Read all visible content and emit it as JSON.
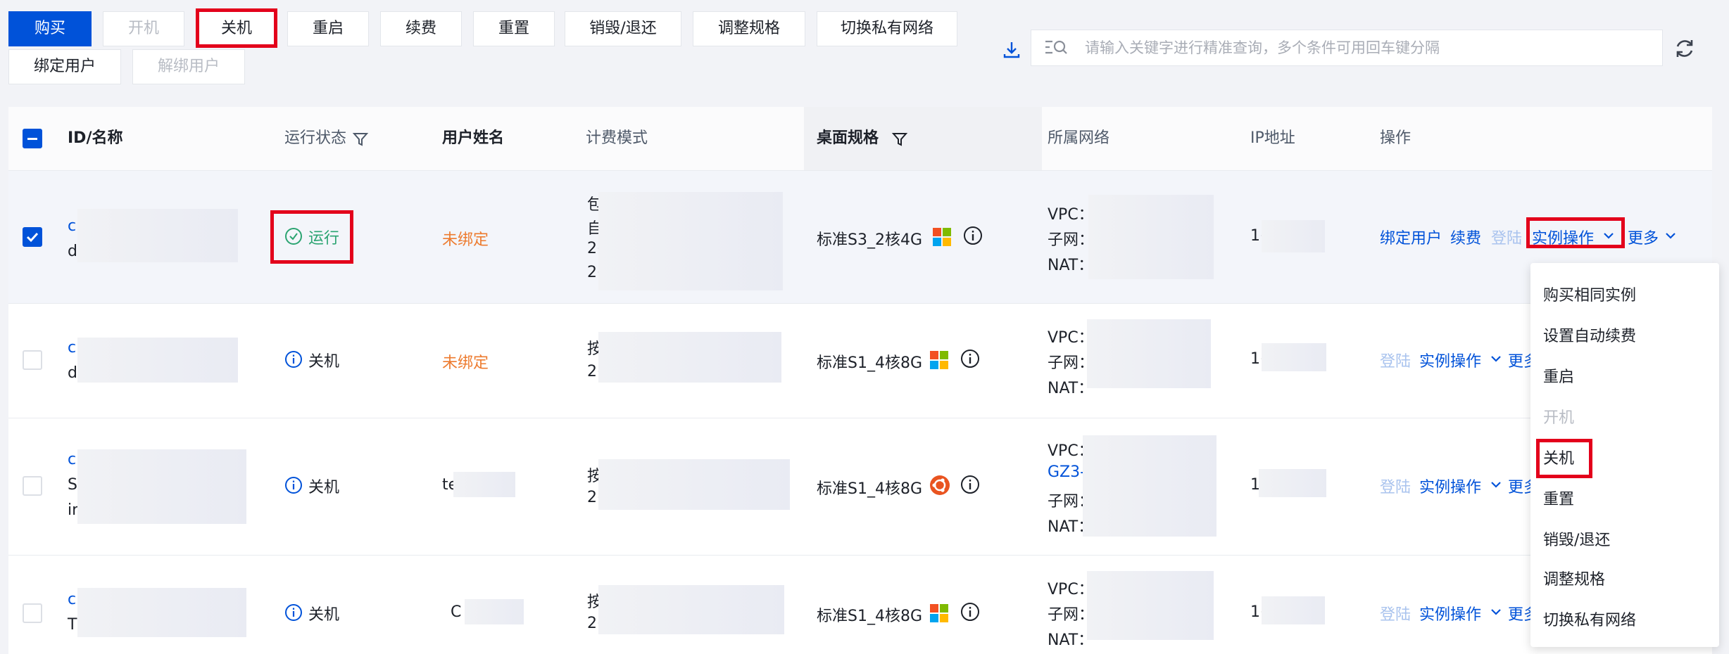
{
  "toolbar": {
    "buy": "购买",
    "start": "开机",
    "stop": "关机",
    "restart": "重启",
    "renew": "续费",
    "reset": "重置",
    "destroy": "销毁/退还",
    "resize": "调整规格",
    "switch_network": "切换私有网络",
    "bind_user": "绑定用户",
    "unbind_user": "解绑用户"
  },
  "search": {
    "placeholder": "请输入关键字进行精准查询，多个条件可用回车键分隔"
  },
  "table": {
    "headers": {
      "id_name": "ID/名称",
      "status": "运行状态",
      "username": "用户姓名",
      "billing": "计费模式",
      "spec": "桌面规格",
      "network": "所属网络",
      "ip": "IP地址",
      "actions": "操作"
    },
    "rows": [
      {
        "id_prefix": "c",
        "name_prefix": "d",
        "status": "运行",
        "user": "未绑定",
        "billing_lines": [
          "包",
          "自",
          "2(",
          "2("
        ],
        "spec": "标准S3_2核4G",
        "os": "windows",
        "net_lines": [
          "VPC：",
          "子网：",
          "NAT："
        ],
        "ip_prefix": "1(",
        "actions": [
          "绑定用户",
          "续费",
          "登陆",
          "实例操作",
          "更多"
        ]
      },
      {
        "id_prefix": "c",
        "name_prefix": "d",
        "status": "关机",
        "user": "未绑定",
        "billing_lines": [
          "按",
          "2("
        ],
        "spec": "标准S1_4核8G",
        "os": "windows",
        "net_lines": [
          "VPC：",
          "子网：",
          "NAT："
        ],
        "ip_prefix": "1(",
        "actions": [
          "登陆",
          "实例操作",
          "更多"
        ]
      },
      {
        "id_prefix": "c",
        "name_prefix": "S",
        "name_prefix2": "ir",
        "status": "关机",
        "user": "te",
        "billing_lines": [
          "按",
          "2("
        ],
        "spec": "标准S1_4核8G",
        "os": "ubuntu",
        "net_lines": [
          "VPC：",
          "GZ3-",
          "子网：",
          "NAT："
        ],
        "ip_prefix": "1",
        "actions": [
          "登陆",
          "实例操作",
          "更多"
        ]
      },
      {
        "id_prefix": "c",
        "name_prefix": "T",
        "status": "关机",
        "user": "C",
        "billing_lines": [
          "按",
          "2("
        ],
        "spec": "标准S1_4核8G",
        "os": "windows",
        "net_lines": [
          "VPC：",
          "子网：",
          "NAT："
        ],
        "ip_prefix": "1(",
        "actions": [
          "登陆",
          "实例操作",
          "更多"
        ]
      }
    ]
  },
  "dropdown": {
    "items": [
      "购买相同实例",
      "设置自动续费",
      "重启",
      "开机",
      "关机",
      "重置",
      "销毁/退还",
      "调整规格",
      "切换私有网络"
    ]
  },
  "icons": {
    "download": "download-icon",
    "search": "search-filter-icon",
    "refresh": "refresh-icon",
    "filter": "filter-icon",
    "info": "info-icon",
    "windows": "windows-logo-icon",
    "ubuntu": "ubuntu-logo-icon",
    "check_circle": "check-circle-icon",
    "chevron": "chevron-down-icon"
  },
  "colors": {
    "primary": "#0052d9",
    "highlight": "#e3001b",
    "warning": "#ed7b2f",
    "success": "#2ba471"
  }
}
